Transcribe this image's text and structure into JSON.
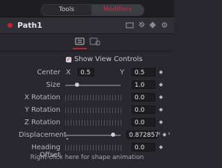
{
  "tabs": {
    "tools": "Tools",
    "modifiers": "Modifiers"
  },
  "header": {
    "title": "Path1"
  },
  "show_view_controls": {
    "label": "Show View Controls",
    "checked": true
  },
  "center": {
    "label": "Center",
    "x_label": "X",
    "x_value": "0.5",
    "y_label": "Y",
    "y_value": "0.5"
  },
  "size": {
    "label": "Size",
    "value": "1.0"
  },
  "x_rotation": {
    "label": "X Rotation",
    "value": "0.0"
  },
  "y_rotation": {
    "label": "Y Rotation",
    "value": "0.0"
  },
  "z_rotation": {
    "label": "Z Rotation",
    "value": "0.0"
  },
  "displacement": {
    "label": "Displacement",
    "value": "0.872857"
  },
  "heading_offset": {
    "label": "Heading Offset",
    "value": "0.0"
  },
  "footer": "Right-click here for shape animation",
  "colors": {
    "accent": "#d7263e"
  },
  "icons": [
    "tools-tab",
    "modifiers-tab",
    "enable-dot",
    "pin-icon",
    "lock-icon",
    "reset-icon",
    "settings-icon",
    "controls-icon",
    "keyframe-icon",
    "nav-prev-icon",
    "nav-next-icon"
  ]
}
